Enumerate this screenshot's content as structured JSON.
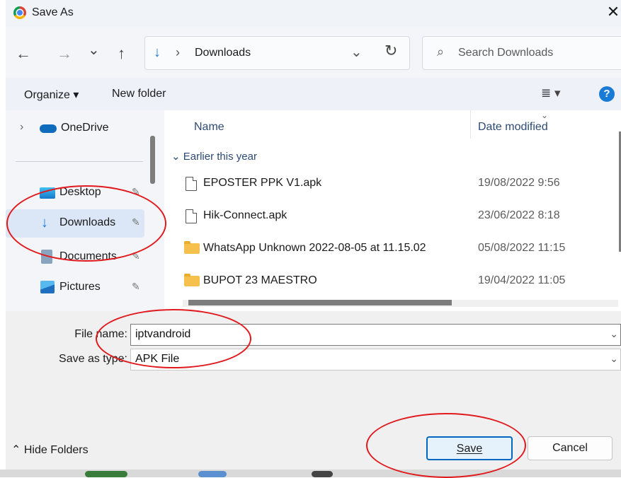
{
  "window": {
    "title": "Save As"
  },
  "nav": {
    "back": "←",
    "forward": "→",
    "recent": "⌄",
    "up": "↑",
    "refresh": "↻"
  },
  "address": {
    "arrow": "↓",
    "separator": "›",
    "location": "Downloads",
    "dropdown": "⌄"
  },
  "search": {
    "placeholder": "Search Downloads",
    "icon": "⌕"
  },
  "toolbar": {
    "organize": "Organize ▾",
    "new_folder": "New folder",
    "view": "≣ ▾",
    "help": "?"
  },
  "sidebar": {
    "items": [
      {
        "label": "OneDrive",
        "icon": "cloud-icon"
      },
      {
        "label": "Desktop",
        "icon": "desktop-icon"
      },
      {
        "label": "Downloads",
        "icon": "download-icon"
      },
      {
        "label": "Documents",
        "icon": "documents-icon"
      },
      {
        "label": "Pictures",
        "icon": "pictures-icon"
      }
    ],
    "pin": "📌"
  },
  "files": {
    "columns": {
      "name": "Name",
      "date": "Date modified"
    },
    "group": "Earlier this year",
    "rows": [
      {
        "name": "EPOSTER PPK V1.apk",
        "date": "19/08/2022 9:56",
        "type": "file"
      },
      {
        "name": "Hik-Connect.apk",
        "date": "23/06/2022 8:18",
        "type": "file"
      },
      {
        "name": "WhatsApp Unknown 2022-08-05 at 11.15.02",
        "date": "05/08/2022 11:15",
        "type": "folder"
      },
      {
        "name": "BUPOT 23 MAESTRO",
        "date": "19/04/2022 11:05",
        "type": "folder"
      }
    ]
  },
  "form": {
    "file_name_label": "File name:",
    "file_name_value": "iptvandroid",
    "save_type_label": "Save as type:",
    "save_type_value": "APK File"
  },
  "footer": {
    "hide_folders": "Hide Folders",
    "save": "Save",
    "cancel": "Cancel"
  },
  "colors": {
    "accent": "#1a7bd6",
    "annotation": "#e0191d"
  }
}
